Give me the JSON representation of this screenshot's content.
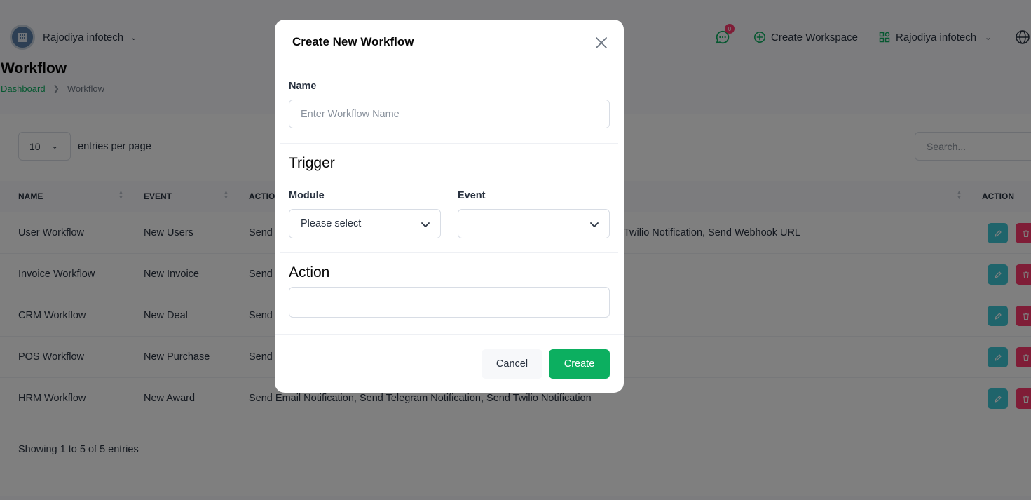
{
  "header": {
    "company_name": "Rajodiya infotech",
    "messages_badge": "0",
    "create_workspace_label": "Create Workspace",
    "workspace_name": "Rajodiya infotech"
  },
  "page": {
    "title": "Workflow",
    "breadcrumb": [
      "Dashboard",
      "Workflow"
    ]
  },
  "table": {
    "entries_value": "10",
    "entries_label": "entries per page",
    "search_placeholder": "Search...",
    "columns": [
      "NAME",
      "EVENT",
      "ACTIO",
      "ACTION"
    ],
    "rows": [
      {
        "name": "User Workflow",
        "event": "New Users",
        "action_left": "Send",
        "action_right": "Twilio Notification, Send Webhook URL"
      },
      {
        "name": "Invoice Workflow",
        "event": "New Invoice",
        "action_left": "Send",
        "action_right": ""
      },
      {
        "name": "CRM Workflow",
        "event": "New Deal",
        "action_left": "Send",
        "action_right": ""
      },
      {
        "name": "POS Workflow",
        "event": "New Purchase",
        "action_left": "Send",
        "action_right": ""
      },
      {
        "name": "HRM Workflow",
        "event": "New Award",
        "action_left": "Send Email Notification, Send Telegram Notification, Send Twilio Notification",
        "action_right": ""
      }
    ],
    "showing_text": "Showing 1 to 5 of 5 entries"
  },
  "modal": {
    "title": "Create New Workflow",
    "name_label": "Name",
    "name_placeholder": "Enter Workflow Name",
    "name_value": "",
    "trigger_title": "Trigger",
    "module_label": "Module",
    "module_value": "Please select",
    "event_label": "Event",
    "event_value": "",
    "action_title": "Action",
    "action_value": "",
    "cancel_label": "Cancel",
    "create_label": "Create"
  },
  "colors": {
    "primary": "#0caf60",
    "edit": "#3ec9d6",
    "delete": "#ff3a6e"
  }
}
